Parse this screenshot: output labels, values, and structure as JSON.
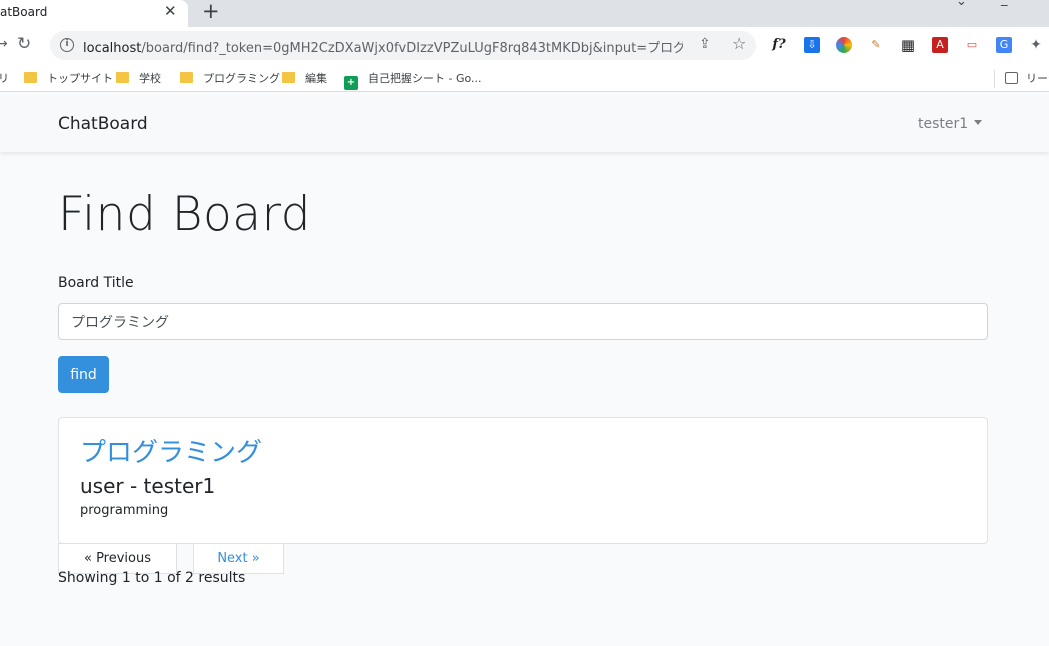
{
  "browser": {
    "tab_title": "atBoard",
    "tab_close": "✕",
    "new_tab": "+",
    "url_host": "localhost",
    "url_path": "/board/find?_token=0gMH2CzDXaWjx0fvDIzzVPZuLUgF8rq843tMKDbj&input=プログラミ...",
    "extensions": [
      "f?",
      "⇩",
      "●",
      "✎",
      "▦",
      "A",
      "▭",
      "G",
      "✦"
    ],
    "bookmarks": [
      "リ",
      "トップサイト",
      "学校",
      "プログラミング",
      "編集",
      "自己把握シート - Go..."
    ],
    "reading_list": "リーデ"
  },
  "navbar": {
    "brand": "ChatBoard",
    "user": "tester1"
  },
  "page": {
    "title": "Find Board",
    "field_label": "Board Title",
    "input_value": "プログラミング",
    "find_button": "find"
  },
  "result_card": {
    "title": "プログラミング",
    "subtitle": "user - tester1",
    "text": "programming"
  },
  "pagination": {
    "previous": "« Previous",
    "next": "Next »",
    "summary": "Showing 1 to 1 of 2 results"
  },
  "colors": {
    "primary": "#3490dc",
    "page_bg": "#f8fafc",
    "navbar_bg": "#f8f9fa"
  }
}
